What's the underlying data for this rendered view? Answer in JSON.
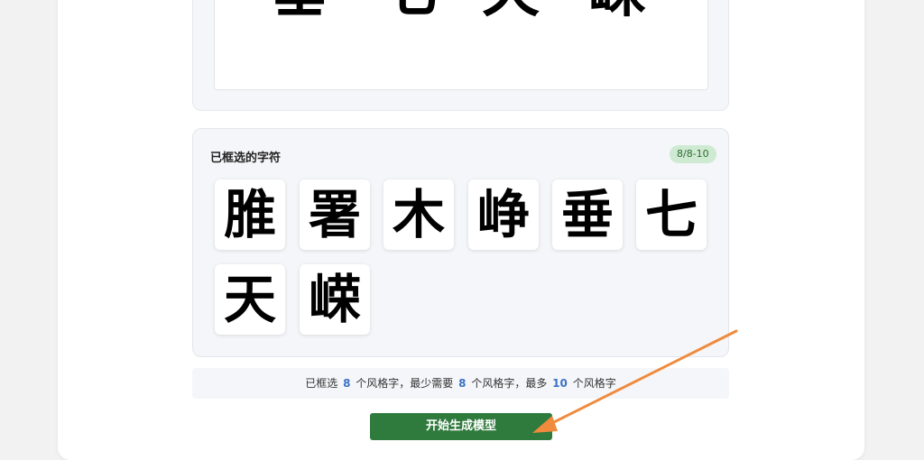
{
  "preview": {
    "glyphs": [
      "垂",
      "七",
      "天",
      "嵘"
    ]
  },
  "selected": {
    "title": "已框选的字符",
    "badge": "8/8-10",
    "glyphs": [
      "脽",
      "署",
      "木",
      "峥",
      "垂",
      "七",
      "天",
      "嵘"
    ]
  },
  "info": {
    "prefix": "已框选",
    "selected_count": "8",
    "unit1": "个风格字，最少需要",
    "min_count": "8",
    "unit2": "个风格字，最多",
    "max_count": "10",
    "unit3": "个风格字"
  },
  "actions": {
    "start_label": "开始生成模型"
  },
  "colors": {
    "accent_green": "#2f7a3d",
    "badge_bg": "#cfead2",
    "number_blue": "#3b73c6",
    "annotation_arrow": "#f08a3c"
  }
}
